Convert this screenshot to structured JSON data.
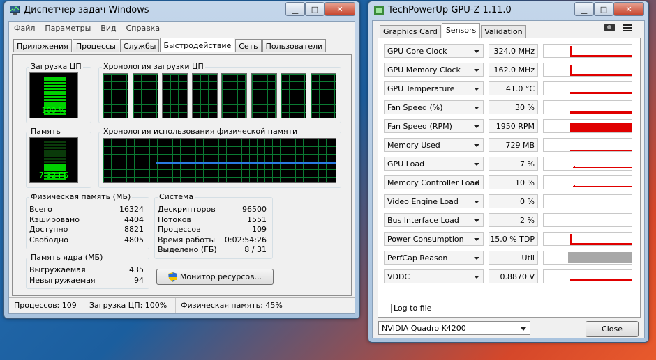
{
  "taskmgr": {
    "title": "Диспетчер задач Windows",
    "menu": [
      "Файл",
      "Параметры",
      "Вид",
      "Справка"
    ],
    "tabs": [
      "Приложения",
      "Процессы",
      "Службы",
      "Быстродействие",
      "Сеть",
      "Пользователи"
    ],
    "active_tab": 3,
    "cpu_group": "Загрузка ЦП",
    "cpu_value": "100 %",
    "cpu_fraction": 1.0,
    "cpu_history_group": "Хронология загрузки ЦП",
    "cpu_core_count": 8,
    "mem_group": "Память",
    "mem_value": "7,32 ГБ",
    "mem_fraction": 0.45,
    "mem_history_group": "Хронология использования физической памяти",
    "phys_mem": {
      "label": "Физическая память (МБ)",
      "rows": [
        [
          "Всего",
          "16324"
        ],
        [
          "Кэшировано",
          "4404"
        ],
        [
          "Доступно",
          "8821"
        ],
        [
          "Свободно",
          "4805"
        ]
      ]
    },
    "kernel_mem": {
      "label": "Память ядра (МБ)",
      "rows": [
        [
          "Выгружаемая",
          "435"
        ],
        [
          "Невыгружаемая",
          "94"
        ]
      ]
    },
    "system": {
      "label": "Система",
      "rows": [
        [
          "Дескрипторов",
          "96500"
        ],
        [
          "Потоков",
          "1551"
        ],
        [
          "Процессов",
          "109"
        ],
        [
          "Время работы",
          "0:02:54:26"
        ],
        [
          "Выделено (ГБ)",
          "8 / 31"
        ]
      ]
    },
    "resource_button": "Монитор ресурсов...",
    "status": [
      "Процессов: 109",
      "Загрузка ЦП: 100%",
      "Физическая память: 45%"
    ]
  },
  "gpuz": {
    "title": "TechPowerUp GPU-Z 1.11.0",
    "tabs": [
      "Graphics Card",
      "Sensors",
      "Validation"
    ],
    "active_tab": 1,
    "sensors": [
      {
        "name": "GPU Core Clock",
        "value": "324.0 MHz",
        "level": 0.25,
        "kind": "spike"
      },
      {
        "name": "GPU Memory Clock",
        "value": "162.0 MHz",
        "level": 0.2,
        "kind": "spike"
      },
      {
        "name": "GPU Temperature",
        "value": "41.0 °C",
        "level": 0.2,
        "kind": "line"
      },
      {
        "name": "Fan Speed (%)",
        "value": "30 %",
        "level": 0.15,
        "kind": "line"
      },
      {
        "name": "Fan Speed (RPM)",
        "value": "1950 RPM",
        "level": 0.8,
        "kind": "fill"
      },
      {
        "name": "Memory Used",
        "value": "729 MB",
        "level": 0.1,
        "kind": "line"
      },
      {
        "name": "GPU Load",
        "value": "7 %",
        "level": 0.07,
        "kind": "sparse"
      },
      {
        "name": "Memory Controller Load",
        "value": "10 %",
        "level": 0.1,
        "kind": "sparse"
      },
      {
        "name": "Video Engine Load",
        "value": "0 %",
        "level": 0.0,
        "kind": "none"
      },
      {
        "name": "Bus Interface Load",
        "value": "2 %",
        "level": 0.02,
        "kind": "dot"
      },
      {
        "name": "Power Consumption",
        "value": "15.0 % TDP",
        "level": 0.15,
        "kind": "spike"
      },
      {
        "name": "PerfCap Reason",
        "value": "Util",
        "level": 0.9,
        "kind": "grey"
      },
      {
        "name": "VDDC",
        "value": "0.8870 V",
        "level": 0.25,
        "kind": "line"
      }
    ],
    "log_label": "Log to file",
    "gpu_select": "NVIDIA Quadro K4200",
    "close_label": "Close",
    "colors": {
      "graph": "#e00000",
      "perfcap": "#a8a8a8"
    }
  }
}
